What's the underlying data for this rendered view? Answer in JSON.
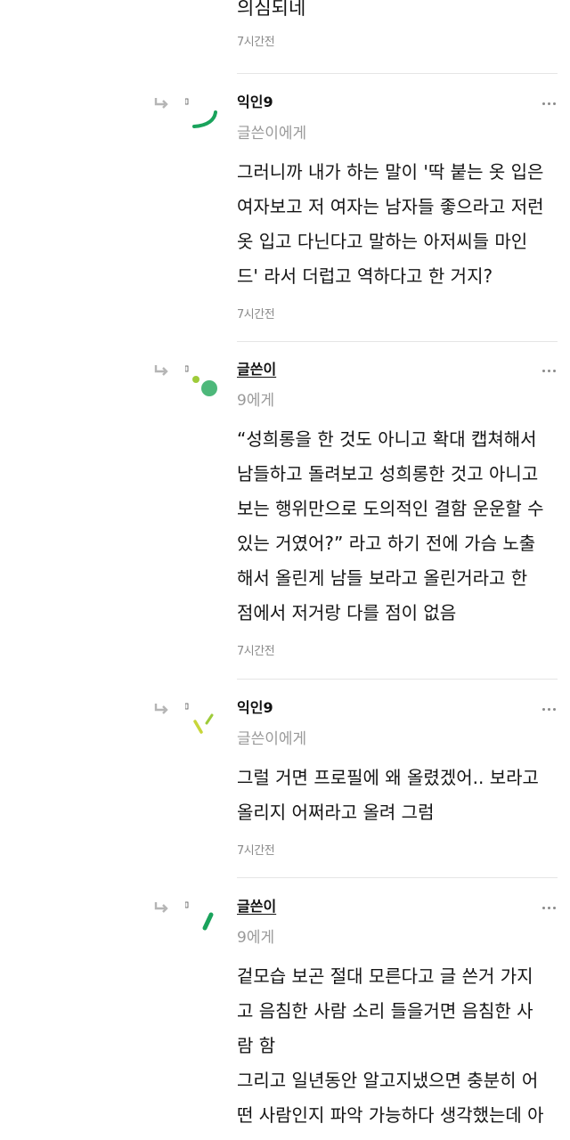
{
  "top_fragment": {
    "text": "의심되네",
    "time": "7시간전"
  },
  "comments": [
    {
      "author": "익인9",
      "target": "글쓴이에게",
      "body": "그러니까 내가 하는 말이 '딱 붙는 옷 입은\n여자보고 저 여자는 남자들 좋으라고 저런\n옷 입고 다닌다고 말하는 아저씨들 마인\n드' 라서 더럽고 역하다고 한 거지?",
      "time": "7시간전",
      "more": "···"
    },
    {
      "author": "글쓴이",
      "target": "9에게",
      "body": "“성희롱을 한 것도 아니고 확대 캡쳐해서\n남들하고 돌려보고 성희롱한 것고 아니고\n보는 행위만으로 도의적인 결함 운운할 수\n있는 거였어?” 라고 하기 전에 가슴 노출\n해서 올린게 남들 보라고 올린거라고 한\n점에서 저거랑 다를 점이 없음",
      "time": "7시간전",
      "more": "···"
    },
    {
      "author": "익인9",
      "target": "글쓴이에게",
      "body": "그럴 거면 프로필에 왜 올렸겠어.. 보라고\n올리지 어쩌라고 올려 그럼",
      "time": "7시간전",
      "more": "···"
    },
    {
      "author": "글쓴이",
      "target": "9에게",
      "body": "겉모습 보곤 절대 모른다고 글 쓴거 가지\n고 음침한 사람 소리 들을거면 음침한 사\n람 함\n그리고 일년동안 알고지냈으면 충분히 어\n떤 사람인지 파악 가능하다 생각했는데 아",
      "more": "···"
    }
  ],
  "colors": {
    "green_dark": "#1aa35c",
    "green_mid": "#4db87a",
    "green_light": "#9ecb3a",
    "yellow_green": "#c8d63a",
    "muted_text": "#9a9a9a"
  },
  "icons": {
    "reply": "reply-arrow-icon",
    "more": "more-dots-icon"
  }
}
